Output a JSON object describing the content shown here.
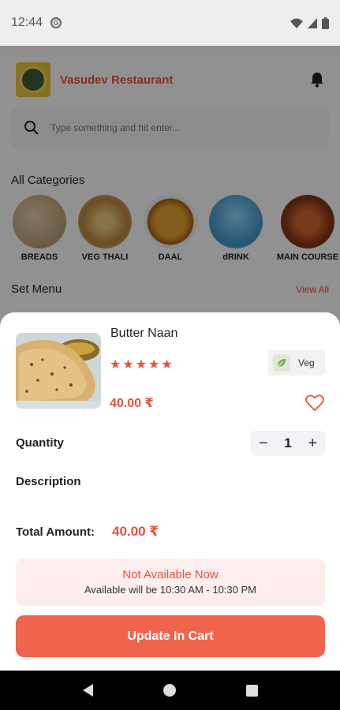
{
  "status_bar": {
    "time": "12:44"
  },
  "app": {
    "restaurant_name": "Vasudev Restaurant",
    "search_placeholder": "Type something and hit enter...",
    "categories_title": "All Categories",
    "categories": [
      {
        "label": "BREADS",
        "color": "#c9a77a"
      },
      {
        "label": "VEG THALI",
        "color": "#d6b06a"
      },
      {
        "label": "DAAL",
        "color": "#d9932f"
      },
      {
        "label": "dRINK",
        "color": "#7fc4e6"
      },
      {
        "label": "MAIN COURSE",
        "color": "#b5512a"
      }
    ],
    "set_menu_title": "Set Menu",
    "view_all": "View All"
  },
  "product": {
    "name": "Butter Naan",
    "stars": "★★★★★",
    "rating": 5,
    "veg_label": "Veg",
    "price": "40.00 ₹",
    "quantity_label": "Quantity",
    "quantity": "1",
    "minus": "−",
    "plus": "+",
    "description_label": "Description",
    "total_label": "Total Amount:",
    "total_value": "40.00 ₹",
    "availability_title": "Not Available Now",
    "availability_sub": "Available will be 10:30 AM - 10:30 PM",
    "cart_button": "Update In Cart"
  },
  "icons": {
    "bell": "bell-icon",
    "search": "search-icon",
    "heart": "heart-outline-icon",
    "leaf": "leaf-icon"
  },
  "colors": {
    "accent": "#e8503f",
    "button": "#f0644d",
    "availability_bg": "#fdeeed"
  }
}
